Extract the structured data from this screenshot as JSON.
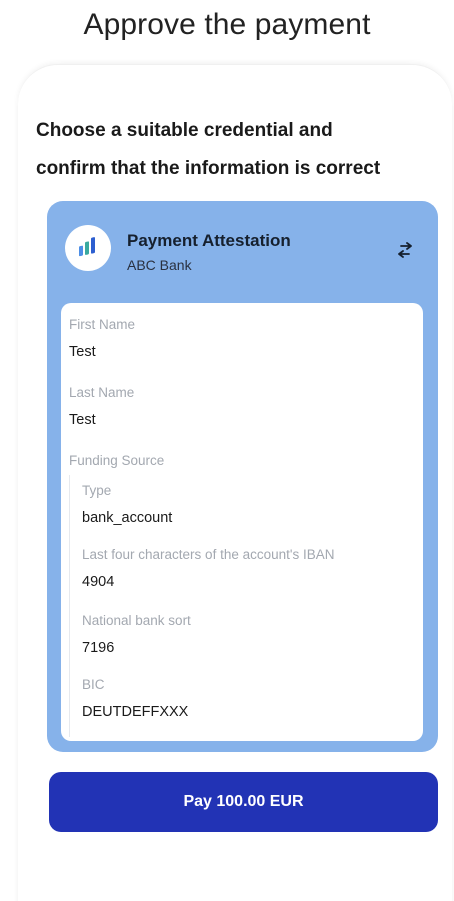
{
  "header": {
    "title": "Approve the payment"
  },
  "instruction": {
    "line1": "Choose a suitable credential and",
    "line2": "confirm that the information is correct"
  },
  "credential": {
    "title": "Payment Attestation",
    "issuer": "ABC Bank",
    "icon": "bank-logo-icon",
    "switch_icon": "swap-arrows-icon",
    "fields": [
      {
        "label": "First Name",
        "value": "Test"
      },
      {
        "label": "Last Name",
        "value": "Test"
      }
    ],
    "group": {
      "label": "Funding Source",
      "fields": [
        {
          "label": "Type",
          "value": "bank_account"
        },
        {
          "label": "Last four characters of the account's IBAN",
          "value": "4904"
        },
        {
          "label": "National bank sort",
          "value": "7196"
        },
        {
          "label": "BIC",
          "value": "DEUTDEFFXXX"
        }
      ]
    }
  },
  "pay_button": {
    "label": "Pay 100.00 EUR"
  },
  "colors": {
    "card_background": "#86b2ea",
    "button_background": "#2233b5",
    "label_gray": "#a3a8b0"
  }
}
